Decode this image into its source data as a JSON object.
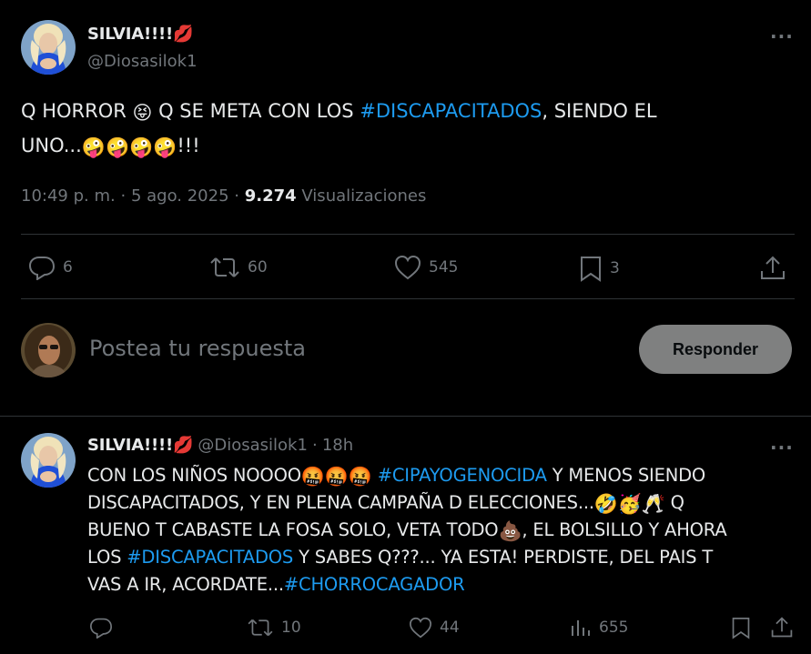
{
  "main_tweet": {
    "author_name": "SILVIA!!!!",
    "author_emoji": "💋",
    "author_handle": "@Diosasilok1",
    "text_part1": "Q HORROR ",
    "emoji1": "😝",
    "text_part2": " Q SE META CON LOS ",
    "hashtag1": "#DISCAPACITADOS",
    "text_part3": ", SIENDO EL",
    "text_line2": "UNO...",
    "emoji_line2": "🤪🤪🤪🤪",
    "text_line2_end": "!!!",
    "time": "10:49 p. m.",
    "sep": "·",
    "date": "5 ago. 2025",
    "views_count": "9.274",
    "views_label": "Visualizaciones",
    "stats": {
      "replies": "6",
      "retweets": "60",
      "likes": "545",
      "bookmarks": "3"
    }
  },
  "compose": {
    "placeholder": "Postea tu respuesta",
    "button_label": "Responder"
  },
  "reply": {
    "author_name": "SILVIA!!!!",
    "author_emoji": "💋",
    "author_handle": "@Diosasilok1",
    "time_sep": "·",
    "time": "18h",
    "l1a": "CON LOS NIÑOS NOOOO",
    "e1": "🤬🤬🤬",
    "h1": "#CIPAYOGENOCIDA",
    "l1b": " Y MENOS SIENDO",
    "l2a": "DISCAPACITADOS, Y EN PLENA CAMPAÑA D ELECCIONES...",
    "e2": "🤣🥳🥂",
    "l2b": " Q",
    "l3a": "BUENO T CABASTE LA FOSA SOLO, VETA TODO",
    "e3": "💩",
    "l3b": ", EL BOLSILLO Y AHORA",
    "l4a": "LOS ",
    "h2": "#DISCAPACITADOS",
    "l4b": " Y SABES Q???... YA ESTA! PERDISTE, DEL PAIS T",
    "l5a": "VAS A IR, ACORDATE...",
    "h3": "#CHORROCAGADOR",
    "stats": {
      "replies": "",
      "retweets": "10",
      "likes": "44",
      "views": "655"
    }
  }
}
